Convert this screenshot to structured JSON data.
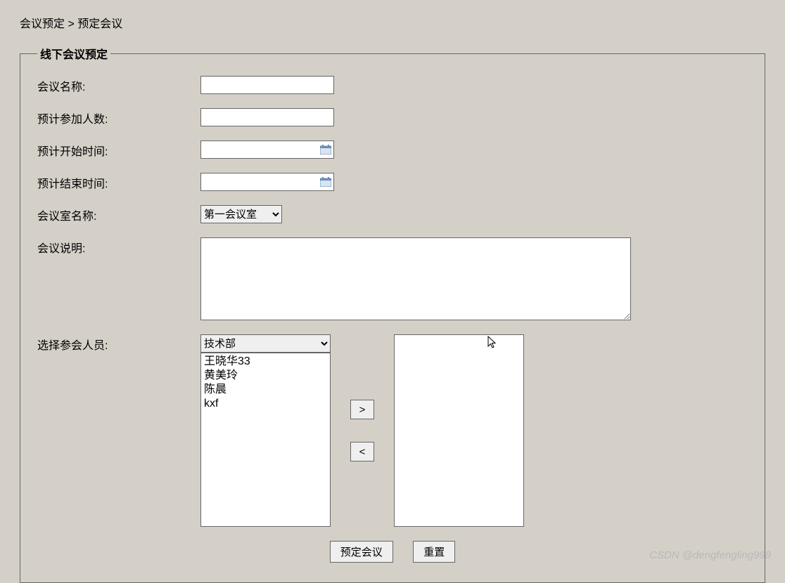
{
  "breadcrumb": {
    "level1": "会议预定",
    "separator": ">",
    "level2": "预定会议"
  },
  "form": {
    "legend": "线下会议预定",
    "fields": {
      "meeting_name": {
        "label": "会议名称:",
        "value": ""
      },
      "attendee_count": {
        "label": "预计参加人数:",
        "value": ""
      },
      "start_time": {
        "label": "预计开始时间:",
        "value": ""
      },
      "end_time": {
        "label": "预计结束时间:",
        "value": ""
      },
      "room": {
        "label": "会议室名称:",
        "selected": "第一会议室"
      },
      "description": {
        "label": "会议说明:",
        "value": ""
      },
      "participants": {
        "label": "选择参会人员:",
        "department_selected": "技术部",
        "available": [
          "王晓华33",
          "黄美玲",
          "陈晨",
          "kxf"
        ],
        "selected": []
      }
    },
    "transfer": {
      "add": ">",
      "remove": "<"
    },
    "buttons": {
      "submit": "预定会议",
      "reset": "重置"
    }
  },
  "watermark": "CSDN @dengfengling999"
}
